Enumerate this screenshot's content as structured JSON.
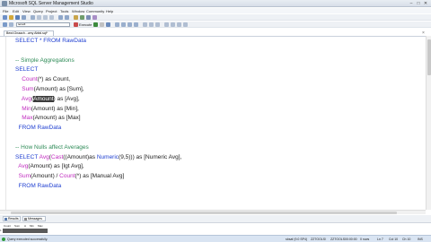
{
  "window": {
    "title": "Microsoft SQL Server Management Studio",
    "buttons": [
      "–",
      "□",
      "✕"
    ]
  },
  "menu": [
    "File",
    "Edit",
    "View",
    "Query",
    "Project",
    "Tools",
    "Window",
    "Community",
    "Help"
  ],
  "toolbar": {
    "database": "tersoft",
    "execute_label": "Execute"
  },
  "document_tab": {
    "label": "Bewl.Gnaach...umy Abfal.sql*"
  },
  "editor": {
    "lines": [
      [
        {
          "t": "SELECT * FROM RawData",
          "c": "kw"
        }
      ],
      [],
      [
        {
          "t": "-- Simple Aggregations",
          "c": "cm"
        }
      ],
      [
        {
          "t": "SELECT",
          "c": "kw"
        }
      ],
      [
        {
          "t": "    "
        },
        {
          "t": "Count",
          "c": "fn"
        },
        {
          "t": "(*) as Count,"
        }
      ],
      [
        {
          "t": "    "
        },
        {
          "t": "Sum",
          "c": "fn"
        },
        {
          "t": "(Amount) as [Sum],"
        }
      ],
      [
        {
          "t": "    "
        },
        {
          "t": "Avg",
          "c": "fn"
        },
        {
          "t": "("
        },
        {
          "t": "Amount",
          "c": "sel"
        },
        {
          "t": ") as [Avg],"
        }
      ],
      [
        {
          "t": "    "
        },
        {
          "t": "Min",
          "c": "fn"
        },
        {
          "t": "(Amount) as [Min],"
        }
      ],
      [
        {
          "t": "    "
        },
        {
          "t": "Max",
          "c": "fn"
        },
        {
          "t": "(Amount) as [Max]"
        }
      ],
      [
        {
          "t": "  FROM RawData",
          "c": "kw"
        }
      ],
      [],
      [
        {
          "t": "-- How Nulls affect Averages",
          "c": "cm"
        }
      ],
      [
        {
          "t": "SELECT ",
          "c": "kw"
        },
        {
          "t": "Avg",
          "c": "fn"
        },
        {
          "t": "("
        },
        {
          "t": "Cast",
          "c": "fn"
        },
        {
          "t": "((Amount)as "
        },
        {
          "t": "Numeric",
          "c": "kw"
        },
        {
          "t": "(9,5))) as [Numeric Avg],"
        }
      ],
      [
        {
          "t": "  "
        },
        {
          "t": "Avg",
          "c": "fn"
        },
        {
          "t": "(Amount) as [Igt Avg],"
        }
      ],
      [
        {
          "t": "  "
        },
        {
          "t": "Sum",
          "c": "fn"
        },
        {
          "t": "(Amount) / "
        },
        {
          "t": "Count",
          "c": "fn"
        },
        {
          "t": "(*) as [Manual Avg]"
        }
      ],
      [
        {
          "t": "  FROM RawData",
          "c": "kw"
        }
      ]
    ]
  },
  "results": {
    "tabs": [
      "Results",
      "Messages"
    ],
    "columns": [
      "Count",
      "Sum",
      "A",
      "Min",
      "Max"
    ],
    "row_number": "1"
  },
  "status": {
    "message": "Query executed successfully.",
    "server": "sbsaf (9.0 SP4)",
    "user": "ZZTOOLS\\",
    "database": "ZZTOOLS",
    "time": "00:00:00",
    "rows": "0 rows",
    "ln": "Ln 7",
    "col": "Col 10",
    "ch": "Ch 10",
    "mode": "INS"
  },
  "colors": {
    "keyword": "#1f3fd1",
    "function": "#c02bbf",
    "comment": "#2e8b57",
    "selection": "#3b3b3b"
  }
}
